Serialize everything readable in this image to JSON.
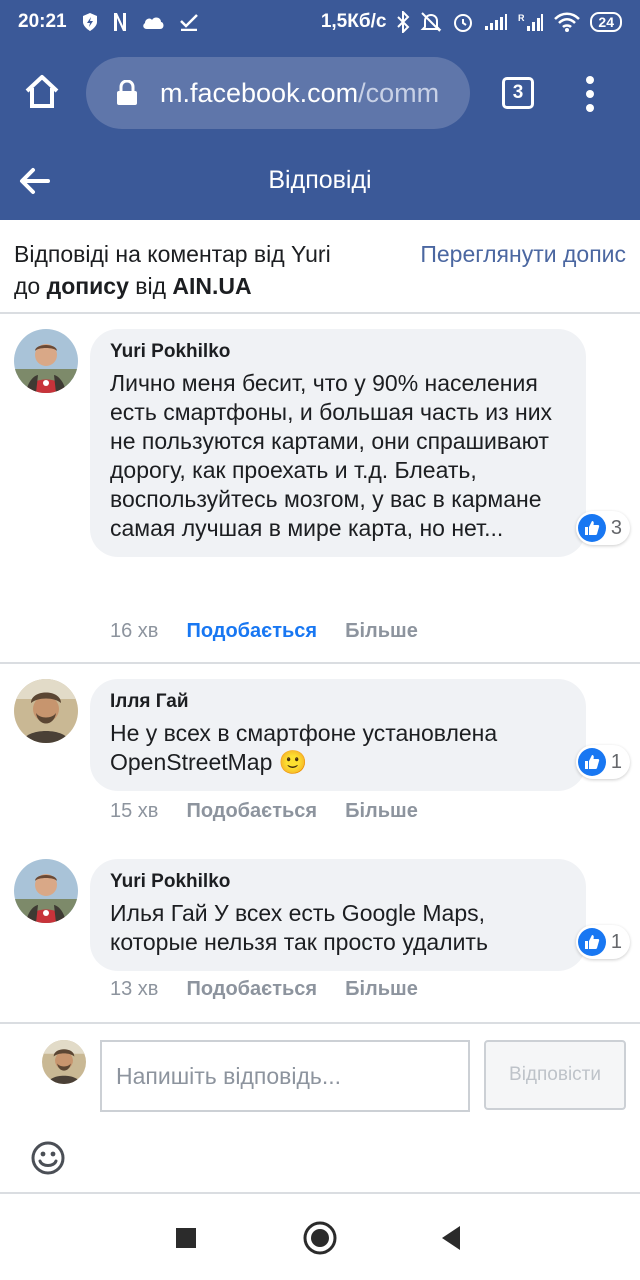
{
  "status": {
    "time": "20:21",
    "speed": "1,5Кб/с",
    "battery": "24"
  },
  "browser": {
    "url_host": "m.facebook.com",
    "url_path": "/comm",
    "tab_count": "3"
  },
  "header": {
    "title": "Відповіді"
  },
  "context": {
    "line1": "Відповіді на коментар від Yuri",
    "line2_prefix": "до ",
    "line2_bold1": "допису",
    "line2_mid": " від ",
    "line2_bold2": "AIN.UA",
    "view_post": "Переглянути допис"
  },
  "comments": [
    {
      "author": "Yuri Pokhilko",
      "text": "Лично меня бесит, что у 90% населения есть смартфоны, и большая часть из них не пользуются картами, они спрашивают дорогу, как проехать и т.д. Блеать, воспользуйтесь мозгом, у вас в кармане самая лучшая в мире карта, но нет...",
      "reactions": "3",
      "time": "16 хв",
      "like_label": "Подобається",
      "more_label": "Більше",
      "liked": true
    },
    {
      "author": "Ілля Гай",
      "text": "Не у всех в смартфоне установлена OpenStreetMap 🙂",
      "reactions": "1",
      "time": "15 хв",
      "like_label": "Подобається",
      "more_label": "Більше",
      "liked": false
    },
    {
      "author": "Yuri Pokhilko",
      "text": "Илья Гай У всех есть Google Maps, которые нельзя так просто удалить",
      "reactions": "1",
      "time": "13 хв",
      "like_label": "Подобається",
      "more_label": "Більше",
      "liked": false
    }
  ],
  "reply": {
    "placeholder": "Напишіть відповідь...",
    "button": "Відповісти"
  },
  "colors": {
    "brand": "#3b5998",
    "like_blue": "#1877f2"
  }
}
